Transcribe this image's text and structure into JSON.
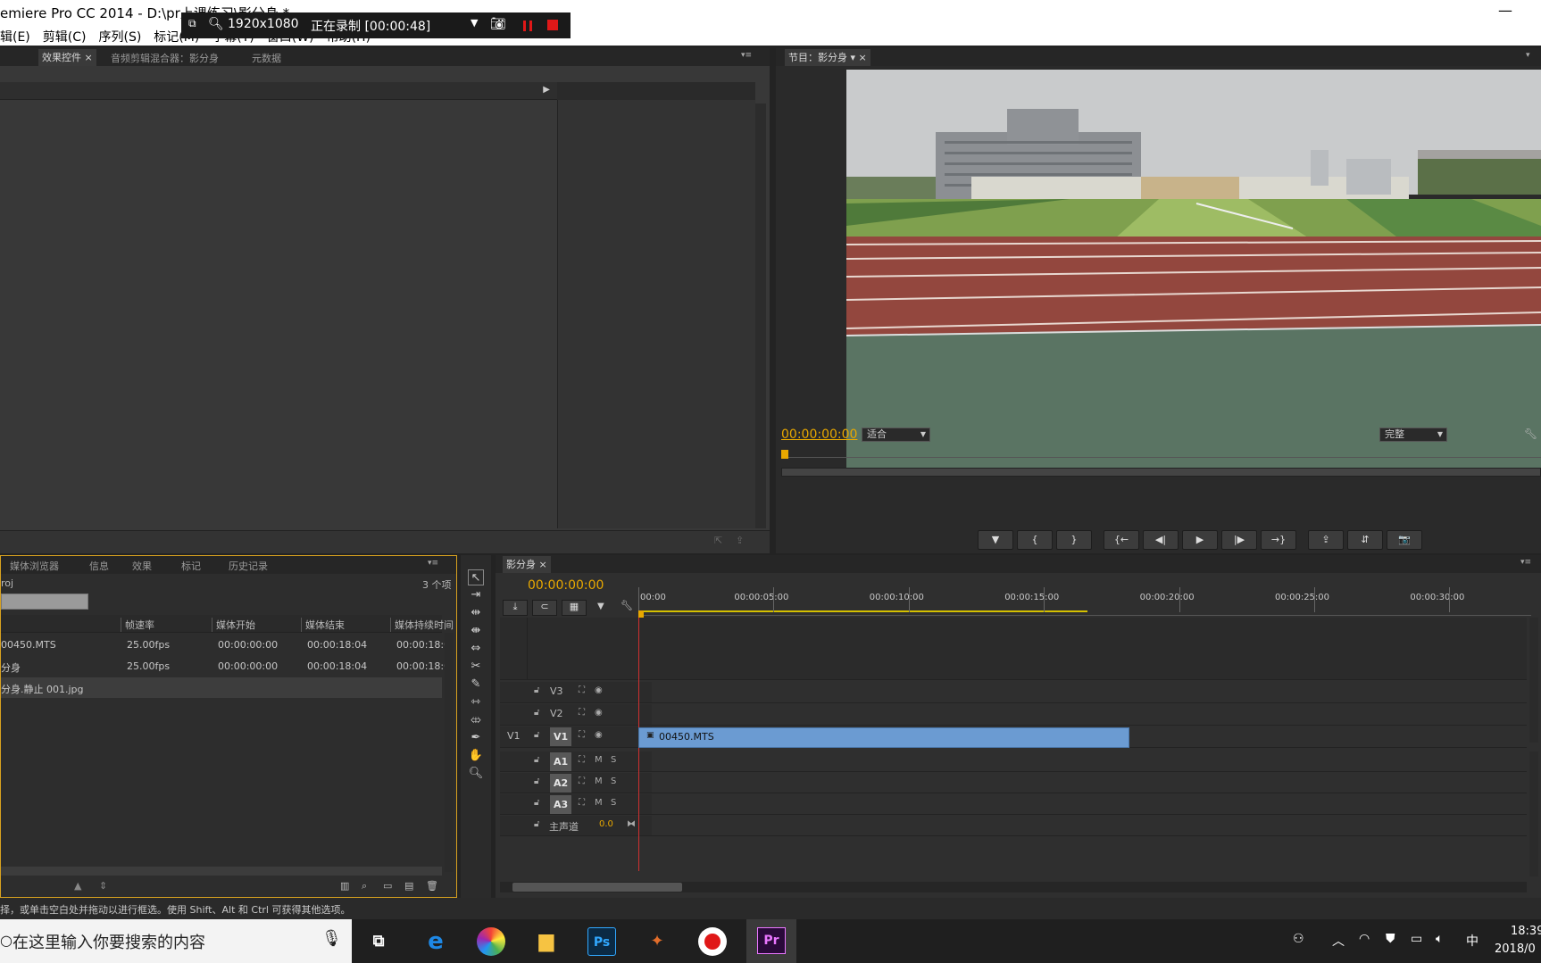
{
  "window": {
    "title": "emiere Pro CC 2014 - D:\\pr上课练习\\影分身 *",
    "minimize_glyph": "—"
  },
  "menu": [
    "辑(E)",
    "剪辑(C)",
    "序列(S)",
    "标记(M)",
    "字幕(T)",
    "窗口(W)",
    "帮助(H)"
  ],
  "recorder": {
    "resolution": "1920x1080",
    "status": "正在录制 [00:00:48]"
  },
  "effect_panel": {
    "tabs": [
      "效果控件",
      "音频剪辑混合器：影分身",
      "元数据"
    ]
  },
  "program_monitor": {
    "tab": "节目：影分身",
    "timecode": "00:00:00:00",
    "fit": "适合",
    "quality": "完整",
    "controls": [
      "▼",
      "{",
      "}",
      "{←",
      "◀|",
      "▶",
      "|▶",
      "→}",
      "⇪",
      "⇵",
      "📷"
    ]
  },
  "project_panel": {
    "tabs": [
      "媒体浏览器",
      "信息",
      "效果",
      "标记",
      "历史记录"
    ],
    "project_name": "roj",
    "item_count": "3 个项",
    "columns": [
      "帧速率",
      "媒体开始",
      "媒体结束",
      "媒体持续时间"
    ],
    "rows": [
      {
        "name": "00450.MTS",
        "fps": "25.00fps",
        "start": "00:00:00:00",
        "end": "00:00:18:04",
        "duration": "00:00:18:0"
      },
      {
        "name": "分身",
        "fps": "25.00fps",
        "start": "00:00:00:00",
        "end": "00:00:18:04",
        "duration": "00:00:18:0"
      },
      {
        "name": "分身.静止 001.jpg",
        "fps": "",
        "start": "",
        "end": "",
        "duration": ""
      }
    ]
  },
  "timeline": {
    "tab": "影分身",
    "timecode": "00:00:00:00",
    "ruler": [
      "00:00",
      "00:00:05:00",
      "00:00:10:00",
      "00:00:15:00",
      "00:00:20:00",
      "00:00:25:00",
      "00:00:30:00"
    ],
    "video_tracks": [
      "V3",
      "V2",
      "V1"
    ],
    "source_patch": "V1",
    "audio_tracks": [
      "A1",
      "A2",
      "A3"
    ],
    "master": {
      "label": "主声道",
      "value": "0.0"
    },
    "clip": {
      "name": "00450.MTS",
      "start_sec": 0,
      "end_sec": 18.16
    }
  },
  "status_bar": "择，或单击空白处并拖动以进行框选。使用 Shift、Alt 和 Ctrl 可获得其他选项。",
  "taskbar": {
    "search_placeholder": "在这里输入你要搜索的内容",
    "apps": [
      "task-view",
      "edge",
      "photos",
      "file-explorer",
      "Ps",
      "game",
      "recorder",
      "Pr"
    ],
    "clock_time": "18:39",
    "clock_date": "2018/0",
    "ime": "中"
  },
  "colors": {
    "accent_timecode": "#e8a800",
    "clip_blue": "#6b9bd2",
    "playhead": "#d03030",
    "panel_focus": "#d7a11f"
  }
}
